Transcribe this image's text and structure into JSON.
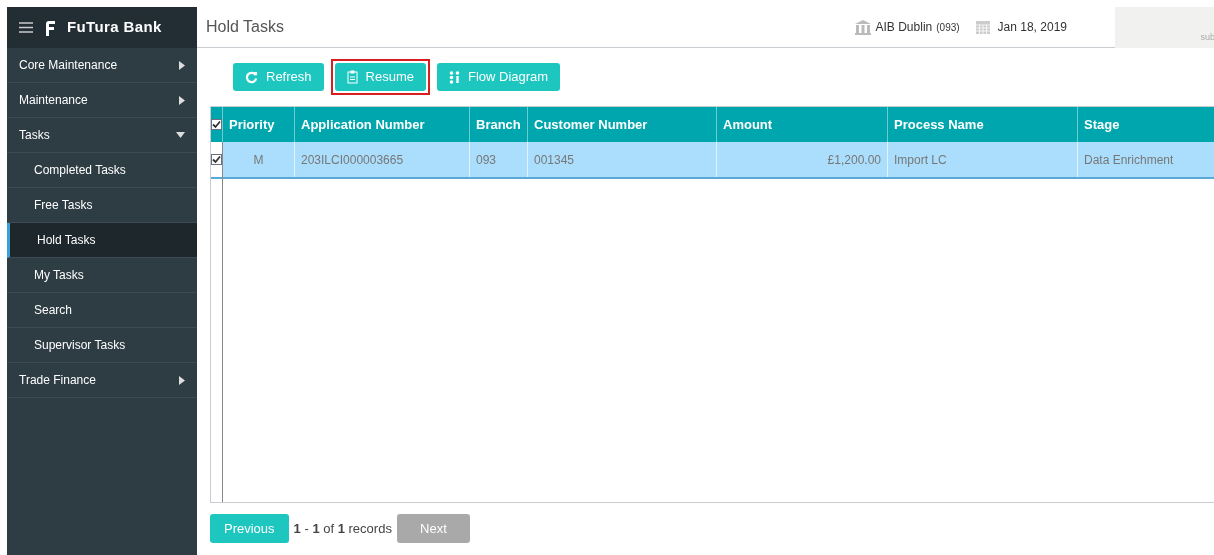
{
  "app": {
    "brand": "FuTura Bank"
  },
  "page_title": "Hold Tasks",
  "header": {
    "branch": "AIB Dublin",
    "branch_code": "(093)",
    "date": "Jan 18, 2019",
    "user_box": "sub"
  },
  "sidebar": {
    "items": [
      {
        "label": "Core Maintenance",
        "expanded": false,
        "selected": false
      },
      {
        "label": "Maintenance",
        "expanded": false,
        "selected": false
      },
      {
        "label": "Tasks",
        "expanded": true,
        "selected": false,
        "children": [
          {
            "label": "Completed Tasks",
            "selected": false
          },
          {
            "label": "Free Tasks",
            "selected": false
          },
          {
            "label": "Hold Tasks",
            "selected": true
          },
          {
            "label": "My Tasks",
            "selected": false
          },
          {
            "label": "Search",
            "selected": false
          },
          {
            "label": "Supervisor Tasks",
            "selected": false
          }
        ]
      },
      {
        "label": "Trade Finance",
        "expanded": false,
        "selected": false
      }
    ]
  },
  "toolbar": [
    {
      "kind": "refresh",
      "label": "Refresh",
      "highlighted": false
    },
    {
      "kind": "resume",
      "label": "Resume",
      "highlighted": true
    },
    {
      "kind": "flow",
      "label": "Flow Diagram",
      "highlighted": false
    }
  ],
  "table": {
    "all_checked": true,
    "columns": [
      "Priority",
      "Application Number",
      "Branch",
      "Customer Number",
      "Amount",
      "Process Name",
      "Stage"
    ],
    "rows": [
      {
        "checked": true,
        "selected": true,
        "cells": [
          "M",
          "203ILCI000003665",
          "093",
          "001345",
          "£1,200.00",
          "Import LC",
          "Data Enrichment"
        ]
      }
    ]
  },
  "pagination": {
    "previous": "Previous",
    "summary": "**1** - **1** of **1** records",
    "next": "Next",
    "next_disabled": true
  }
}
